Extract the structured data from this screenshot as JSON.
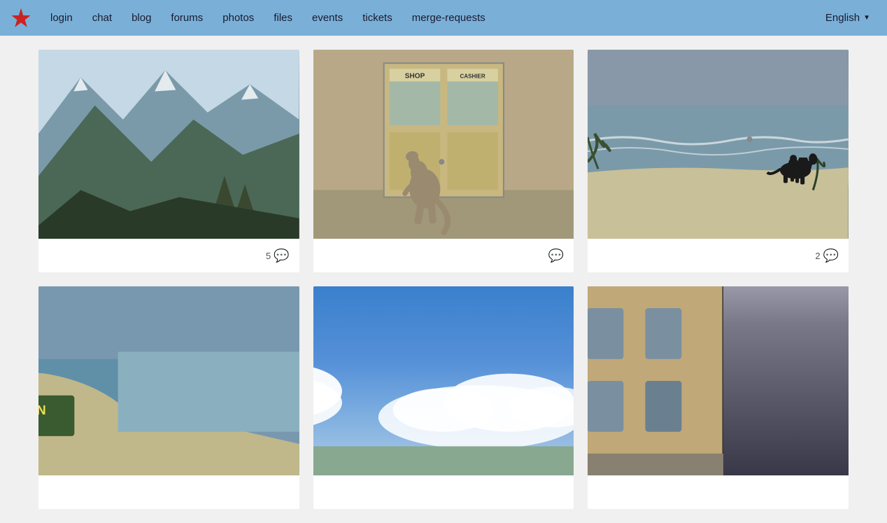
{
  "nav": {
    "logo_alt": "logo",
    "links": [
      {
        "label": "login",
        "href": "#"
      },
      {
        "label": "chat",
        "href": "#"
      },
      {
        "label": "blog",
        "href": "#"
      },
      {
        "label": "forums",
        "href": "#"
      },
      {
        "label": "photos",
        "href": "#"
      },
      {
        "label": "files",
        "href": "#"
      },
      {
        "label": "events",
        "href": "#"
      },
      {
        "label": "tickets",
        "href": "#"
      },
      {
        "label": "merge-requests",
        "href": "#"
      }
    ],
    "language": "English"
  },
  "gallery": {
    "photos": [
      {
        "id": 1,
        "alt": "Mountain landscape with snow",
        "comment_count": "5",
        "has_comments": true
      },
      {
        "id": 2,
        "alt": "Kangaroo outside shop with cashier sign",
        "comment_count": "",
        "has_comments": true
      },
      {
        "id": 3,
        "alt": "Beach scene with person riding horse",
        "comment_count": "2",
        "has_comments": true
      },
      {
        "id": 4,
        "alt": "Coastal caution sign",
        "comment_count": "",
        "has_comments": false
      },
      {
        "id": 5,
        "alt": "Blue sky with clouds",
        "comment_count": "",
        "has_comments": false
      },
      {
        "id": 6,
        "alt": "City architecture with old buildings",
        "comment_count": "",
        "has_comments": false
      }
    ]
  }
}
